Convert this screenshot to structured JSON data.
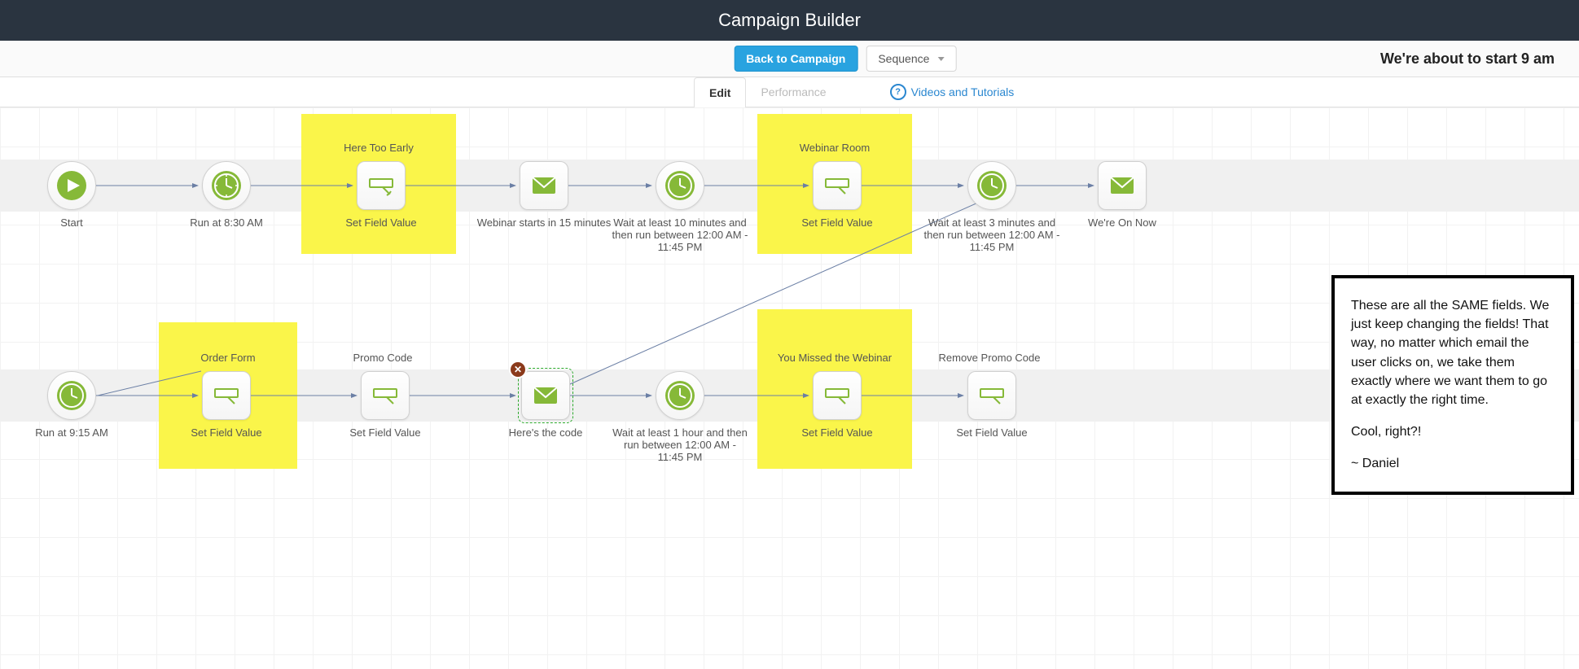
{
  "header": {
    "title": "Campaign Builder"
  },
  "toolbar": {
    "back": "Back to Campaign",
    "sequence": "Sequence",
    "page_title": "We're about to start 9 am"
  },
  "tabs": {
    "edit": "Edit",
    "performance": "Performance"
  },
  "help": {
    "text": "Videos and Tutorials"
  },
  "zones": {
    "here_too_early": "Here Too Early",
    "webinar_room": "Webinar Room",
    "order_form": "Order Form",
    "missed_webinar": "You Missed the Webinar"
  },
  "titles": {
    "promo_code": "Promo Code",
    "remove_promo_code": "Remove Promo Code"
  },
  "nodes": {
    "start": "Start",
    "run_830": "Run at 8:30 AM",
    "sfv1": "Set Field Value",
    "email_15min": "Webinar starts in 15 minutes",
    "wait10": "Wait at least 10 minutes and then run between 12:00 AM - 11:45 PM",
    "sfv2": "Set Field Value",
    "wait3": "Wait at least 3 minutes and then run between 12:00 AM - 11:45 PM",
    "email_on_now": "We're On Now",
    "run_915": "Run at 9:15 AM",
    "sfv3": "Set Field Value",
    "sfv4": "Set Field Value",
    "email_code": "Here's the code",
    "wait1h": "Wait at least 1 hour and then run between 12:00 AM - 11:45 PM",
    "sfv5": "Set Field Value",
    "sfv6": "Set Field Value"
  },
  "note": {
    "p1": "These are all the SAME fields. We just keep changing the fields!  That way, no matter which email the user clicks on, we take them exactly where we want them to go at exactly the right time.",
    "p2": "Cool, right?!",
    "sig": "~ Daniel"
  },
  "colors": {
    "green": "#86b938",
    "yellow": "#faf54a",
    "blueBtn": "#29a3e0"
  }
}
